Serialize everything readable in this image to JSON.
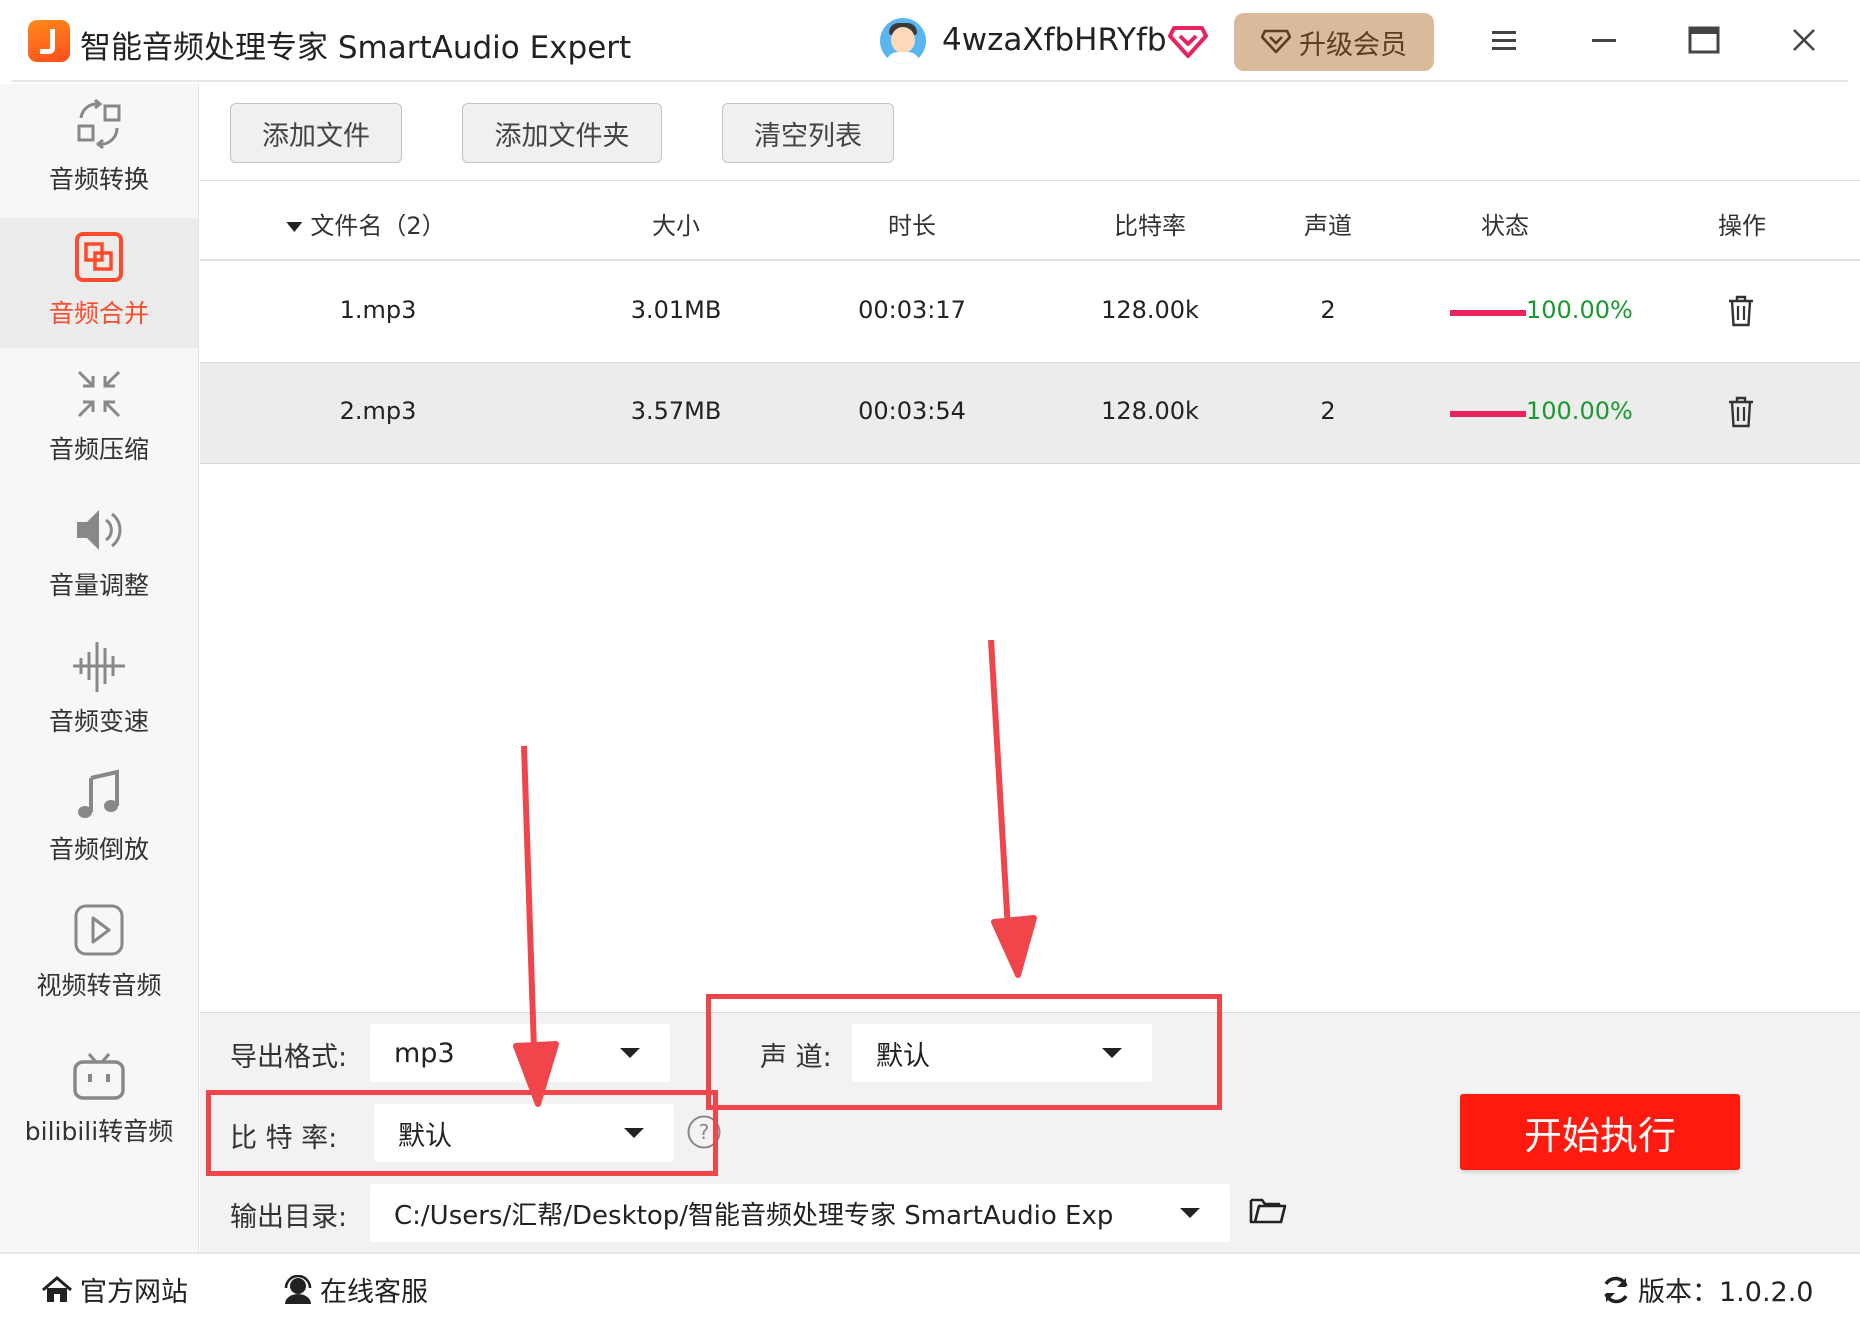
{
  "app": {
    "title": "智能音频处理专家 SmartAudio Expert",
    "username": "4wzaXfbHRYfb",
    "upgrade_label": "升级会员"
  },
  "sidebar": {
    "items": [
      {
        "label": "音频转换",
        "icon": "convert-icon",
        "active": false
      },
      {
        "label": "音频合并",
        "icon": "merge-icon",
        "active": true
      },
      {
        "label": "音频压缩",
        "icon": "compress-icon",
        "active": false
      },
      {
        "label": "音量调整",
        "icon": "volume-icon",
        "active": false
      },
      {
        "label": "音频变速",
        "icon": "speed-icon",
        "active": false
      },
      {
        "label": "音频倒放",
        "icon": "music-note-icon",
        "active": false
      },
      {
        "label": "视频转音频",
        "icon": "play-icon",
        "active": false
      },
      {
        "label": "bilibili转音频",
        "icon": "bilibili-icon",
        "active": false
      }
    ]
  },
  "toolbar": {
    "add_file": "添加文件",
    "add_folder": "添加文件夹",
    "clear_list": "清空列表"
  },
  "table": {
    "columns": [
      "文件名（2）",
      "大小",
      "时长",
      "比特率",
      "声道",
      "状态",
      "操作"
    ],
    "rows": [
      {
        "name": "1.mp3",
        "size": "3.01MB",
        "duration": "00:03:17",
        "bitrate": "128.00k",
        "channels": "2",
        "progress": 1.0,
        "status": "100.00%"
      },
      {
        "name": "2.mp3",
        "size": "3.57MB",
        "duration": "00:03:54",
        "bitrate": "128.00k",
        "channels": "2",
        "progress": 1.0,
        "status": "100.00%"
      }
    ]
  },
  "settings": {
    "format_label": "导出格式:",
    "format_value": "mp3",
    "channel_label": "声 道:",
    "channel_value": "默认",
    "bitrate_label": "比 特 率:",
    "bitrate_value": "默认",
    "output_label": "输出目录:",
    "output_value": "C:/Users/汇帮/Desktop/智能音频处理专家 SmartAudio Exp"
  },
  "start_button": "开始执行",
  "statusbar": {
    "website": "官方网站",
    "support": "在线客服",
    "version": "版本：1.0.2.0"
  },
  "colors": {
    "accent": "#ff4b2b",
    "start_button": "#ff1a0f",
    "progress": "#e8245f",
    "status_text": "#1a9a2e",
    "annotation": "#f0464b",
    "upgrade_button": "#d9bb9b"
  }
}
